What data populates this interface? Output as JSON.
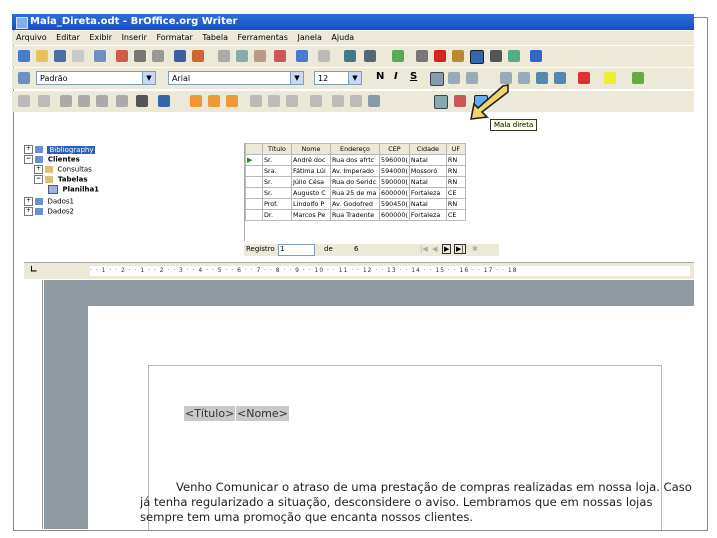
{
  "window": {
    "title": "Mala_Direta.odt - BrOffice.org Writer"
  },
  "menu": [
    "Arquivo",
    "Editar",
    "Exibir",
    "Inserir",
    "Formatar",
    "Tabela",
    "Ferramentas",
    "Janela",
    "Ajuda"
  ],
  "format_toolbar": {
    "style": "Padrão",
    "font": "Arial",
    "size": "12",
    "bold": "N",
    "italic": "I",
    "underline": "S"
  },
  "tooltip": "Mala direta",
  "datasource_tree": [
    {
      "label": "Bibliography",
      "level": 0,
      "selected": true
    },
    {
      "label": "Clientes",
      "level": 0,
      "bold": true
    },
    {
      "label": "Consultas",
      "level": 1
    },
    {
      "label": "Tabelas",
      "level": 1,
      "bold": true
    },
    {
      "label": "Planilha1",
      "level": 2,
      "bold": true
    },
    {
      "label": "Dados1",
      "level": 0
    },
    {
      "label": "Dados2",
      "level": 0
    }
  ],
  "table": {
    "columns": [
      "Título",
      "Nome",
      "Endereço",
      "CEP",
      "Cidade",
      "UF"
    ],
    "rows": [
      [
        "Sr.",
        "André doc",
        "Rua dos afrtc",
        "596000(",
        "Natal",
        "RN"
      ],
      [
        "Sra.",
        "Fátima Lúi",
        "Av. Imperado",
        "594000(",
        "Mossoró",
        "RN"
      ],
      [
        "Sr.",
        "Júlio Césa",
        "Rua do Seridc",
        "590000(",
        "Natal",
        "RN"
      ],
      [
        "Sr.",
        "Augusto C",
        "Rua 25 de ma",
        "600000(",
        "Fortaleza",
        "CE"
      ],
      [
        "Prof.",
        "Lindolfo P",
        "Av. Godofred",
        "590450(",
        "Natal",
        "RN"
      ],
      [
        "Dr.",
        "Marcos Pe",
        "Rua Tradente",
        "600000(",
        "Fortaleza",
        "CE"
      ]
    ]
  },
  "nav": {
    "label": "Registro",
    "record": "1",
    "of": "de",
    "total": "6"
  },
  "ruler": "· · 1 · · 2 · · 1 · · 2 · · 3 · · 4 · · 5 · · 6 · · 7 · · 8 · · 9 · · 10 · · 11 · · 12 · · 13 · · 14 · · 15 · · 16 · · 17 · · 18",
  "document": {
    "field1": "<Título>",
    "field2": "<Nome>",
    "paragraph": "Venho Comunicar o atraso de uma prestação de compras realizadas em nossa loja. Caso já tenha regularizado a situação, desconsidere o aviso. Lembramos que em nossas lojas sempre tem uma promoção que encanta nossos clientes."
  }
}
